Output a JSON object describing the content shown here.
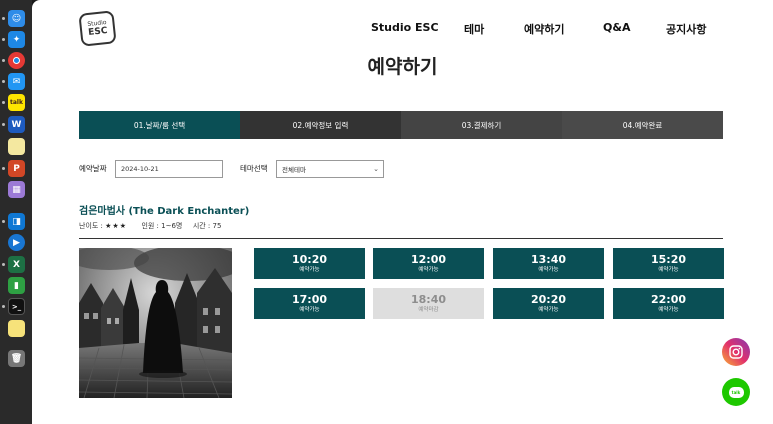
{
  "brand": {
    "logo_line1": "Studio",
    "logo_line2": "ESC"
  },
  "nav": {
    "items": [
      "Studio ESC",
      "테마",
      "예약하기",
      "Q&A",
      "공지사항"
    ]
  },
  "page_title": "예약하기",
  "steps": [
    "01.날짜/룸 선택",
    "02.예약정보 입력",
    "03.결제하기",
    "04.예약완료"
  ],
  "form": {
    "date_label": "예약날짜",
    "date_value": "2024-10-21",
    "theme_label": "테마선택",
    "theme_value": "전체테마"
  },
  "theme": {
    "title": "검은마법사 (The Dark Enchanter)",
    "difficulty_label": "난이도 :",
    "difficulty_stars": "★★★",
    "players": "인원 : 1~6명",
    "time": "시간 : 75"
  },
  "slots": [
    {
      "time": "10:20",
      "status": "예약가능",
      "available": true
    },
    {
      "time": "12:00",
      "status": "예약가능",
      "available": true
    },
    {
      "time": "13:40",
      "status": "예약가능",
      "available": true
    },
    {
      "time": "15:20",
      "status": "예약가능",
      "available": true
    },
    {
      "time": "17:00",
      "status": "예약가능",
      "available": true
    },
    {
      "time": "18:40",
      "status": "예약마감",
      "available": false
    },
    {
      "time": "20:20",
      "status": "예약가능",
      "available": true
    },
    {
      "time": "22:00",
      "status": "예약가능",
      "available": true
    }
  ],
  "fabs": {
    "instagram": "instagram-icon",
    "chat": "chat-icon",
    "chat_label": "talk"
  },
  "colors": {
    "primary": "#0a4f55",
    "closed": "#dedede"
  }
}
